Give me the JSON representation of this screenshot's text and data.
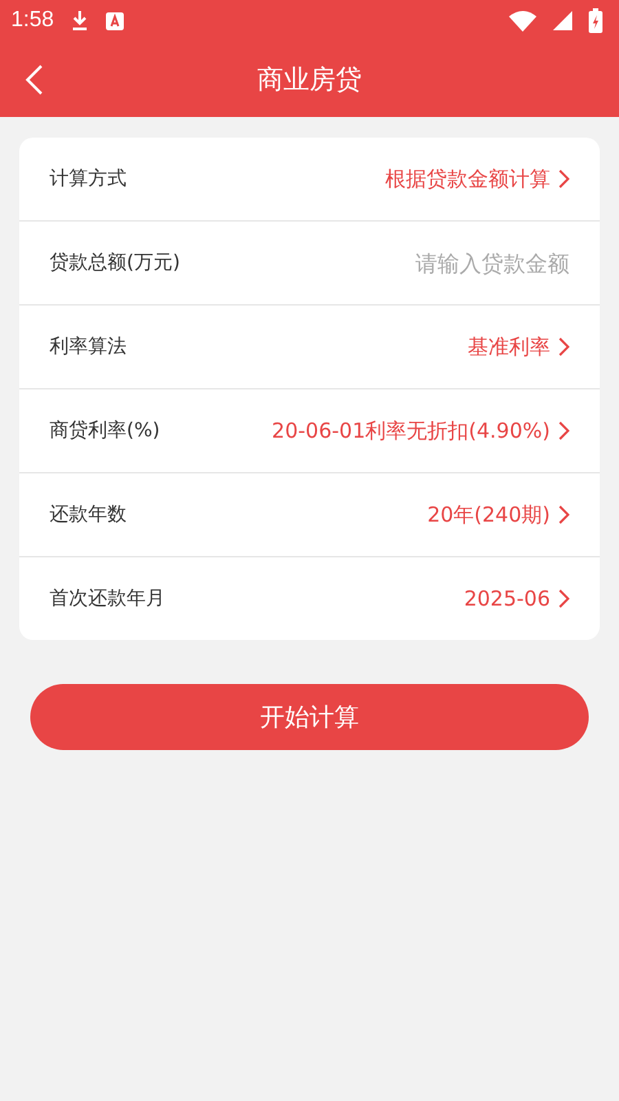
{
  "status_bar": {
    "time": "1:58"
  },
  "header": {
    "title": "商业房贷"
  },
  "rows": [
    {
      "kind": "select",
      "label": "计算方式",
      "value": "根据贷款金额计算"
    },
    {
      "kind": "input",
      "label": "贷款总额(万元)",
      "placeholder": "请输入贷款金额"
    },
    {
      "kind": "select",
      "label": "利率算法",
      "value": "基准利率"
    },
    {
      "kind": "select",
      "label": "商贷利率(%)",
      "value": "20-06-01利率无折扣(4.90%)"
    },
    {
      "kind": "select",
      "label": "还款年数",
      "value": "20年(240期)"
    },
    {
      "kind": "select",
      "label": "首次还款年月",
      "value": "2025-06"
    }
  ],
  "button": "开始计算"
}
